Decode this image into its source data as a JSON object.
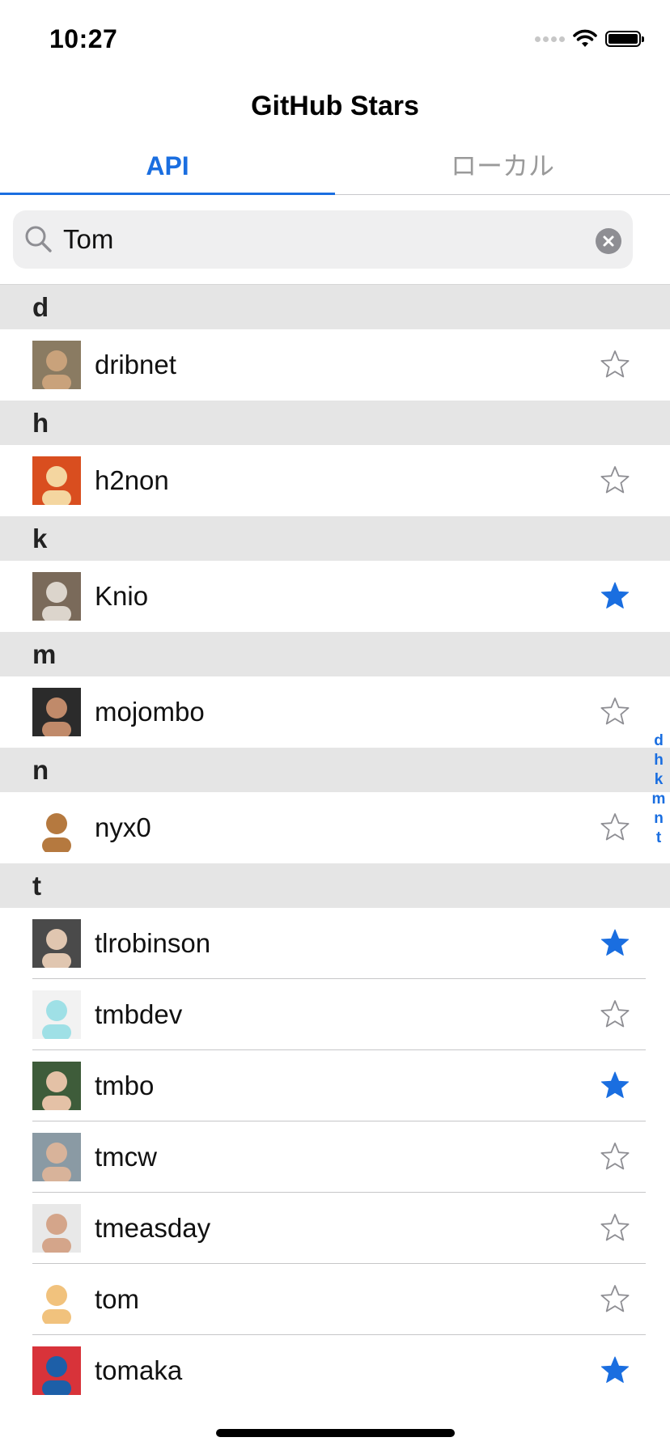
{
  "status_bar": {
    "time": "10:27"
  },
  "nav": {
    "title": "GitHub Stars"
  },
  "tabs": [
    {
      "label": "API",
      "selected": true
    },
    {
      "label": "ローカル",
      "selected": false
    }
  ],
  "search": {
    "value": "Tom"
  },
  "sections": [
    {
      "letter": "d",
      "users": [
        {
          "name": "dribnet",
          "starred": false
        }
      ]
    },
    {
      "letter": "h",
      "users": [
        {
          "name": "h2non",
          "starred": false
        }
      ]
    },
    {
      "letter": "k",
      "users": [
        {
          "name": "Knio",
          "starred": true
        }
      ]
    },
    {
      "letter": "m",
      "users": [
        {
          "name": "mojombo",
          "starred": false
        }
      ]
    },
    {
      "letter": "n",
      "users": [
        {
          "name": "nyx0",
          "starred": false
        }
      ]
    },
    {
      "letter": "t",
      "users": [
        {
          "name": "tlrobinson",
          "starred": true
        },
        {
          "name": "tmbdev",
          "starred": false
        },
        {
          "name": "tmbo",
          "starred": true
        },
        {
          "name": "tmcw",
          "starred": false
        },
        {
          "name": "tmeasday",
          "starred": false
        },
        {
          "name": "tom",
          "starred": false
        },
        {
          "name": "tomaka",
          "starred": true
        }
      ]
    }
  ],
  "section_index": [
    "d",
    "h",
    "k",
    "m",
    "n",
    "t"
  ],
  "colors": {
    "accent": "#1a6ee0",
    "star_empty": "#8e8e93",
    "section_bg": "#e5e5e5"
  },
  "icons": {
    "search": "search-icon",
    "clear": "clear-icon",
    "star_filled": "star-filled-icon",
    "star_empty": "star-outline-icon"
  }
}
